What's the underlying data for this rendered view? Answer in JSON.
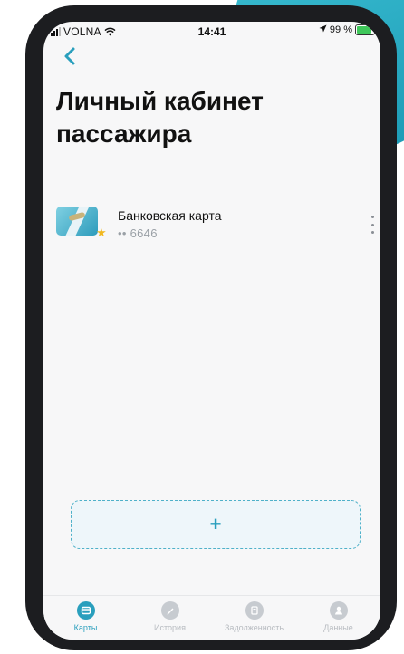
{
  "status_bar": {
    "carrier": "VOLNA",
    "time": "14:41",
    "battery": "99 %"
  },
  "header": {
    "title_line1": "Личный кабинет",
    "title_line2": "пассажира"
  },
  "cards": [
    {
      "name": "Банковская карта",
      "number": "•• 6646",
      "icon": "bank-card-thumbnail",
      "favorite_icon": "star-icon"
    }
  ],
  "add_card": {
    "label": "+"
  },
  "tabs": [
    {
      "label": "Карты",
      "icon": "cards-icon",
      "active": true
    },
    {
      "label": "История",
      "icon": "history-icon",
      "active": false
    },
    {
      "label": "Задолженность",
      "icon": "debt-icon",
      "active": false
    },
    {
      "label": "Данные",
      "icon": "profile-icon",
      "active": false
    }
  ],
  "colors": {
    "accent": "#2a9fbd",
    "frame": "#1c1d20",
    "decor": "#3fc3d6",
    "inactive_tab": "#c7cbd0",
    "star": "#f1b81f"
  }
}
